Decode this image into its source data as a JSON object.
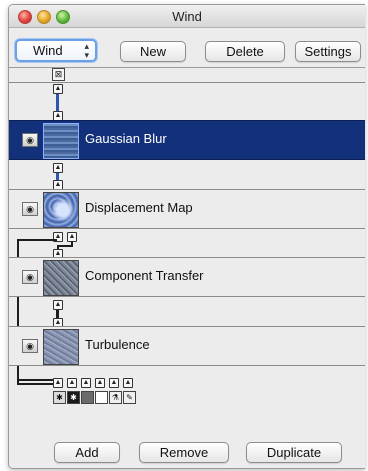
{
  "window": {
    "title": "Wind"
  },
  "toolbar": {
    "popup_label": "Wind",
    "popup_arrows": "⬍",
    "new_label": "New",
    "delete_label": "Delete",
    "settings_label": "Settings"
  },
  "graph": {
    "result_icon": "result-node-icon",
    "nodes": [
      {
        "label": "Gaussian Blur",
        "selected": true,
        "visible": true,
        "thumb_color": "#4e6fa3"
      },
      {
        "label": "Displacement Map",
        "selected": false,
        "visible": true,
        "thumb_color": "#5b79b8"
      },
      {
        "label": "Component Transfer",
        "selected": false,
        "visible": true,
        "thumb_color": "#7f8899"
      },
      {
        "label": "Turbulence",
        "selected": false,
        "visible": true,
        "thumb_color": "#8c98b4"
      }
    ],
    "source_inputs": [
      "source-graphic-icon",
      "source-alpha-icon",
      "background-image-icon",
      "background-alpha-icon",
      "fill-paint-icon",
      "stroke-paint-icon"
    ]
  },
  "footer": {
    "add_label": "Add",
    "remove_label": "Remove",
    "duplicate_label": "Duplicate"
  },
  "colors": {
    "selection": "#13307a",
    "wire": "#1d1d1d",
    "accent_wire": "#2d56b0",
    "popup_focus": "#6aa0e6"
  }
}
